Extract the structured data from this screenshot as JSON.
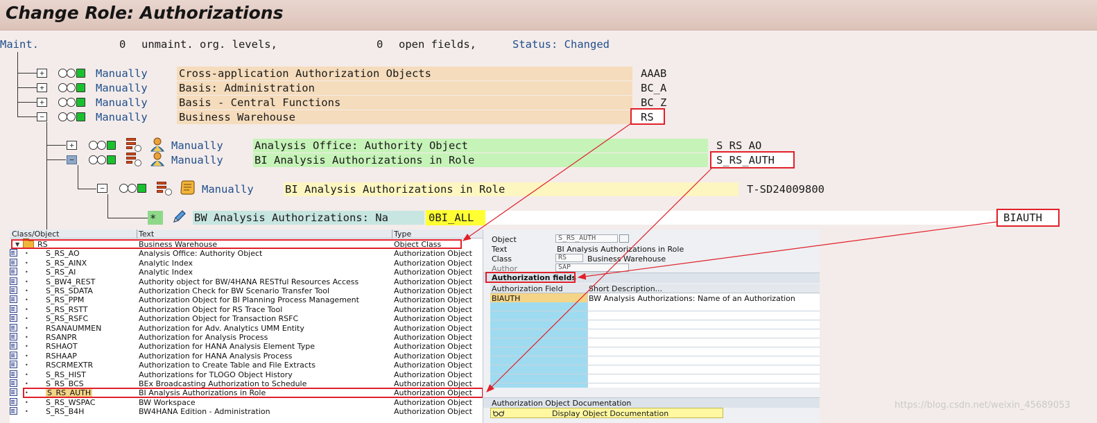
{
  "title": "Change Role: Authorizations",
  "status_line": {
    "maint_label": "Maint.",
    "unmaint_count": "0",
    "unmaint_label": "unmaint. org. levels,",
    "open_count": "0",
    "open_label": "open fields,",
    "status": "Status: Changed"
  },
  "tree": {
    "level1": [
      {
        "status": "Manually",
        "text": "Cross-application Authorization Objects",
        "code": "AAAB"
      },
      {
        "status": "Manually",
        "text": "Basis: Administration",
        "code": "BC_A"
      },
      {
        "status": "Manually",
        "text": "Basis - Central Functions",
        "code": "BC_Z"
      },
      {
        "status": "Manually",
        "text": "Business Warehouse",
        "code": "RS"
      }
    ],
    "level2": [
      {
        "status": "Manually",
        "text": "Analysis Office: Authority Object",
        "code": "S_RS_AO"
      },
      {
        "status": "Manually",
        "text": "BI Analysis Authorizations in Role",
        "code": "S_RS_AUTH"
      }
    ],
    "level3": {
      "status": "Manually",
      "text": "BI Analysis Authorizations in Role",
      "code": "T-SD24009800"
    },
    "level4": {
      "symbol": "*",
      "text": "BW Analysis Authorizations: Na",
      "value": "0BI_ALL",
      "code": "BIAUTH"
    }
  },
  "object_list": {
    "headers": [
      "Class/Object",
      "Text",
      "Type"
    ],
    "rows": [
      {
        "name": "RS",
        "text": "Business Warehouse",
        "type": "Object Class"
      },
      {
        "name": "S_RS_AO",
        "text": "Analysis Office: Authority Object",
        "type": "Authorization Object"
      },
      {
        "name": "S_RS_AINX",
        "text": "Analytic Index",
        "type": "Authorization Object"
      },
      {
        "name": "S_RS_AI",
        "text": "Analytic Index",
        "type": "Authorization Object"
      },
      {
        "name": "S_BW4_REST",
        "text": "Authority object for BW/4HANA RESTful Resources Access",
        "type": "Authorization Object"
      },
      {
        "name": "S_RS_SDATA",
        "text": "Authorization Check for BW Scenario Transfer Tool",
        "type": "Authorization Object"
      },
      {
        "name": "S_RS_PPM",
        "text": "Authorization Object for BI Planning Process Management",
        "type": "Authorization Object"
      },
      {
        "name": "S_RS_RSTT",
        "text": "Authorization Object for RS Trace Tool",
        "type": "Authorization Object"
      },
      {
        "name": "S_RS_RSFC",
        "text": "Authorization Object for Transaction RSFC",
        "type": "Authorization Object"
      },
      {
        "name": "RSANAUMMEN",
        "text": "Authorization for Adv. Analytics UMM Entity",
        "type": "Authorization Object"
      },
      {
        "name": "RSANPR",
        "text": "Authorization for Analysis Process",
        "type": "Authorization Object"
      },
      {
        "name": "RSHAOT",
        "text": "Authorization for HANA Analysis Element Type",
        "type": "Authorization Object"
      },
      {
        "name": "RSHAAP",
        "text": "Authorization for HANA Analysis Process",
        "type": "Authorization Object"
      },
      {
        "name": "RSCRMEXTR",
        "text": "Authorization to Create Table and File Extracts",
        "type": "Authorization Object"
      },
      {
        "name": "S_RS_HIST",
        "text": "Authorizations for TLOGO Object History",
        "type": "Authorization Object"
      },
      {
        "name": "S_RS_BCS",
        "text": "BEx Broadcasting Authorization to Schedule",
        "type": "Authorization Object"
      },
      {
        "name": "S_RS_AUTH",
        "text": "BI Analysis Authorizations in Role",
        "type": "Authorization Object"
      },
      {
        "name": "S_RS_WSPAC",
        "text": "BW Workspace",
        "type": "Authorization Object"
      },
      {
        "name": "S_RS_B4H",
        "text": "BW4HANA Edition - Administration",
        "type": "Authorization Object"
      }
    ]
  },
  "detail": {
    "object_label": "Object",
    "object_value": "S_RS_AUTH",
    "text_label": "Text",
    "text_value": "BI Analysis Authorizations in Role",
    "class_label": "Class",
    "class_code": "RS",
    "class_text": "Business Warehouse",
    "author_label": "Author",
    "author_value": "SAP",
    "fields_section": "Authorization fields",
    "fields_headers": [
      "Authorization Field",
      "Short Description..."
    ],
    "fields": [
      {
        "field": "BIAUTH",
        "description": "BW Analysis Authorizations: Name of an Authorization"
      }
    ],
    "doc_section": "Authorization Object Documentation",
    "doc_button": "Display Object Documentation"
  },
  "watermark": "https://blog.csdn.net/weixin_45689053",
  "colors": {
    "annotation": "#e0202a",
    "link_blue": "#1f4e8c",
    "green_light": "#19c12e"
  }
}
